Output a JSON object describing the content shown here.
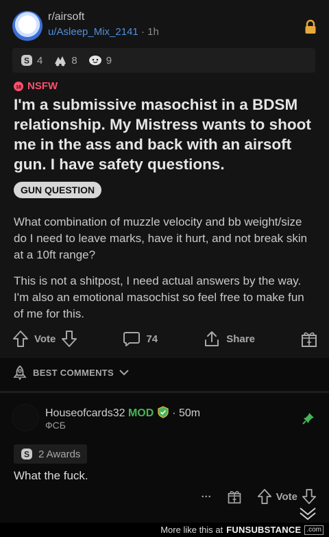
{
  "post": {
    "subreddit": "r/airsoft",
    "username": "u/Asleep_Mix_2141",
    "time": "1h",
    "awards": [
      {
        "icon": "silver-award-icon",
        "count": "4"
      },
      {
        "icon": "helpful-award-icon",
        "count": "8"
      },
      {
        "icon": "wholesome-award-icon",
        "count": "9"
      }
    ],
    "nsfw_label": "NSFW",
    "title": "I'm a submissive masochist in a BDSM relationship. My Mistress wants to shoot me in the ass and back with an airsoft gun. I have safety questions.",
    "flair": "GUN QUESTION",
    "paragraphs": [
      "What combination of muzzle velocity and bb weight/size do I need to leave marks, have it hurt, and not break skin at a 10ft range?",
      "This is not a shitpost, I need actual answers by the way. I'm also an emotional masochist so feel free to make fun of me for this."
    ],
    "vote_label": "Vote",
    "comment_count": "74",
    "share_label": "Share"
  },
  "sort": {
    "label": "BEST COMMENTS"
  },
  "comment": {
    "author": "Houseofcards32",
    "mod_label": "MOD",
    "time": "50m",
    "flair": "ФСБ",
    "awards_label": "2 Awards",
    "text": "What the fuck.",
    "more_label": "···",
    "vote_label": "Vote"
  },
  "footer": {
    "more_text": "More like this at",
    "brand": "FUNSUBSTANCE",
    "domain": ".com"
  },
  "colors": {
    "nsfw": "#ff4f6b",
    "username": "#4f8fdc",
    "mod": "#44b557",
    "lock": "#e8a93a"
  }
}
